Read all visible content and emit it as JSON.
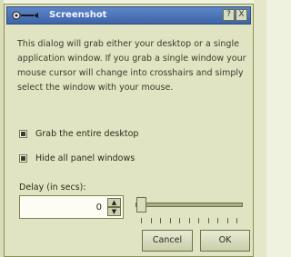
{
  "window": {
    "title": "Screenshot",
    "help_label": "?",
    "close_label": "X"
  },
  "description": "This dialog will grab either your desktop or a single application window. If you grab a single window your mouse cursor will change into crosshairs and simply select the window with your mouse.",
  "options": [
    {
      "label": "Grab the entire desktop",
      "checked": true
    },
    {
      "label": "Hide all panel windows",
      "checked": true
    }
  ],
  "delay": {
    "label": "Delay (in secs):",
    "value": "0",
    "up_glyph": "▲",
    "down_glyph": "▼"
  },
  "slider": {
    "value": 0
  },
  "buttons": {
    "cancel_label": "Cancel",
    "ok_label": "OK"
  },
  "colors": {
    "titlebar": "#4f79bf",
    "dialog_bg": "#e0e4c2",
    "page_bg": "#eef2de"
  }
}
